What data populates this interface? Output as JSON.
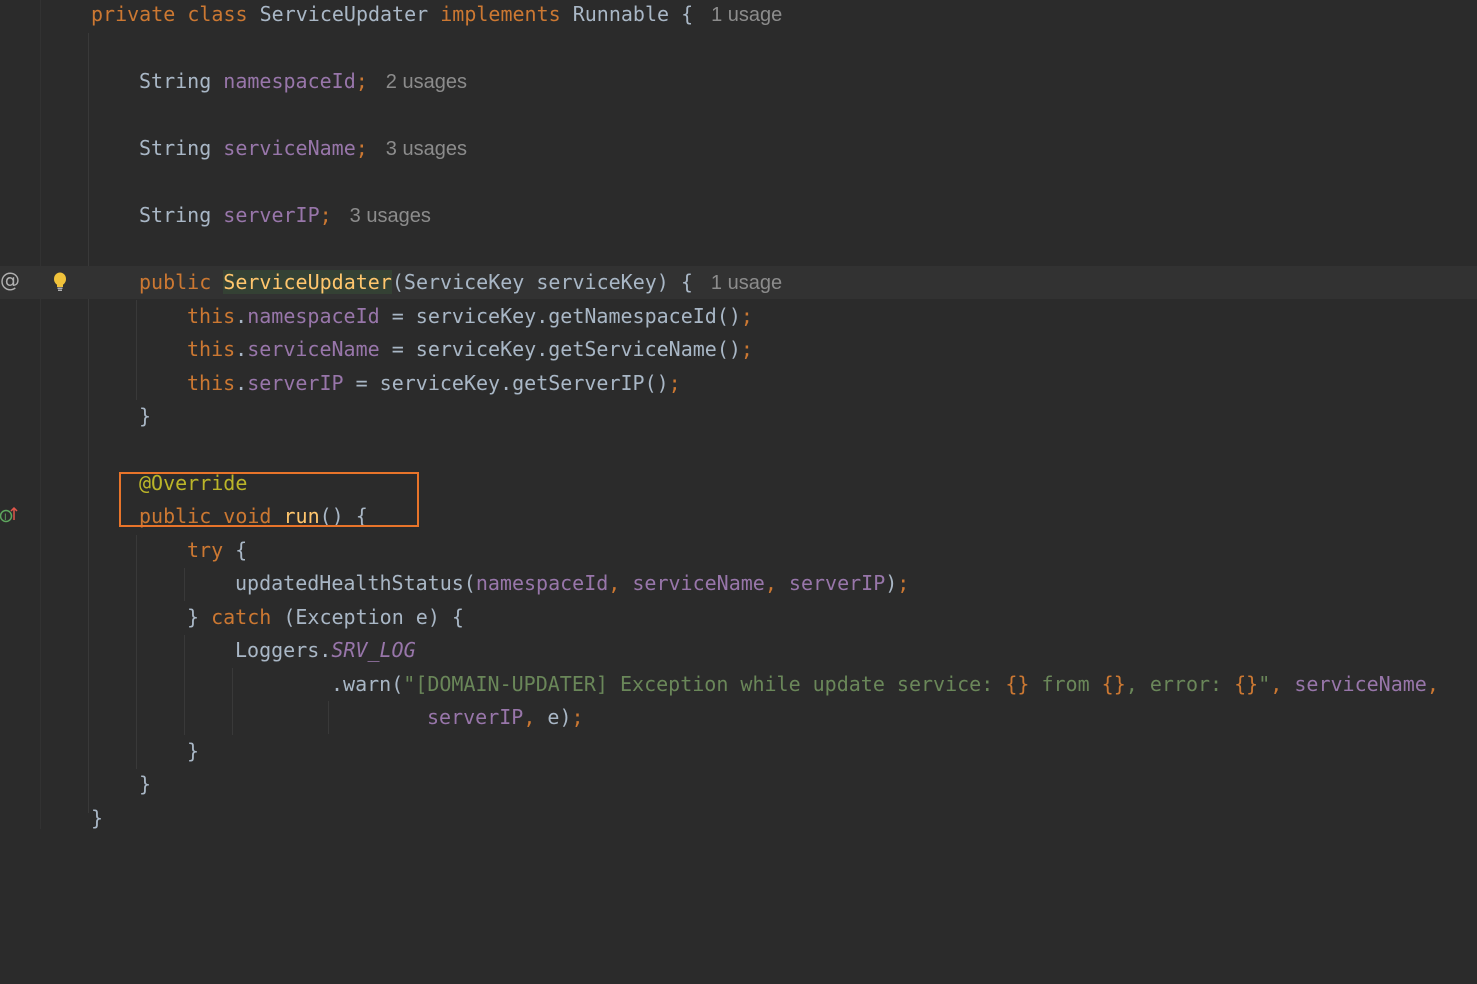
{
  "editor": {
    "lines": {
      "class_decl": {
        "private": "private",
        "class": "class",
        "name": "ServiceUpdater",
        "implements": "implements",
        "iface": "Runnable",
        "brace": "{",
        "hint": "1 usage"
      },
      "field1": {
        "type": "String",
        "name": "namespaceId",
        "semi": ";",
        "hint": "2 usages"
      },
      "field2": {
        "type": "String",
        "name": "serviceName",
        "semi": ";",
        "hint": "3 usages"
      },
      "field3": {
        "type": "String",
        "name": "serverIP",
        "semi": ";",
        "hint": "3 usages"
      },
      "ctor": {
        "public": "public",
        "name": "ServiceUpdater",
        "params": "(ServiceKey serviceKey) {",
        "hint": "1 usage"
      },
      "assign1": {
        "this": "this",
        "dot": ".",
        "field": "namespaceId",
        "rest": " = serviceKey.getNamespaceId()",
        "semi": ";"
      },
      "assign2": {
        "this": "this",
        "dot": ".",
        "field": "serviceName",
        "rest": " = serviceKey.getServiceName()",
        "semi": ";"
      },
      "assign3": {
        "this": "this",
        "dot": ".",
        "field": "serverIP",
        "rest": " = serviceKey.getServerIP()",
        "semi": ";"
      },
      "ctor_close": "}",
      "override": "@Override",
      "run_decl": {
        "public": "public",
        "void": "void",
        "name": "run",
        "rest": "() {"
      },
      "try": {
        "kw": "try",
        "rest": " {"
      },
      "call": {
        "name": "updatedHealthStatus",
        "open": "(",
        "a1": "namespaceId",
        "c1": ", ",
        "a2": "serviceName",
        "c2": ", ",
        "a3": "serverIP",
        "close": ")",
        "semi": ";"
      },
      "catch": {
        "close": "} ",
        "kw": "catch",
        "rest": " (Exception e) {"
      },
      "loggers": {
        "cls": "Loggers.",
        "field": "SRV_LOG"
      },
      "warn": {
        "method": ".warn(",
        "str1": "\"[DOMAIN-UPDATER] Exception while update service: ",
        "ph1": "{}",
        "str2": " from ",
        "ph2": "{}",
        "str3": ", error: ",
        "ph3": "{}",
        "str4": "\"",
        "comma": ", ",
        "arg": "serviceName",
        "comma2": ","
      },
      "warn2": {
        "a1": "serverIP",
        "c1": ", ",
        "a2": "e",
        "close": ")",
        "semi": ";"
      },
      "catch_close": "}",
      "run_close": "}",
      "class_close": "}"
    }
  },
  "gutter": {
    "at_symbol": "@",
    "icons": [
      "lightbulb-icon",
      "implements-method-icon"
    ]
  },
  "colors": {
    "background": "#2b2b2b",
    "keyword": "#cc7832",
    "field": "#9876aa",
    "string": "#6a8759",
    "annotation": "#bbb529",
    "method": "#ffc66d",
    "highlight_box": "#e8742a"
  }
}
